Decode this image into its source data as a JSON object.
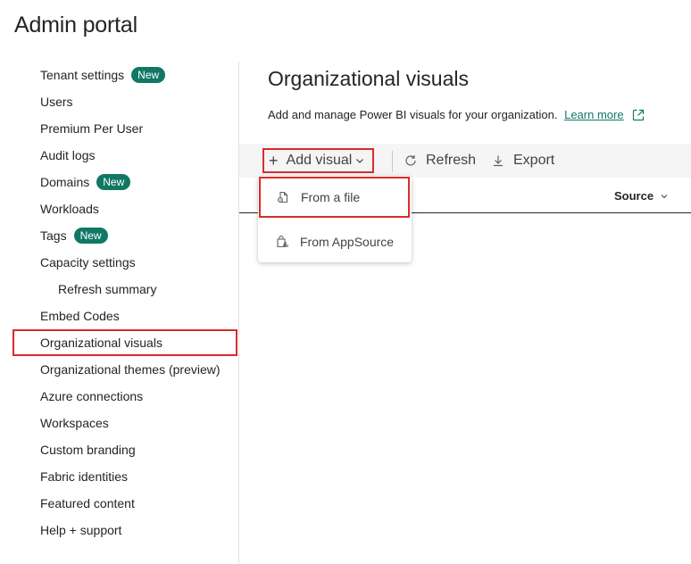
{
  "app": {
    "title": "Admin portal"
  },
  "sidebar": {
    "items": [
      {
        "label": "Tenant settings",
        "badge": "New"
      },
      {
        "label": "Users"
      },
      {
        "label": "Premium Per User"
      },
      {
        "label": "Audit logs"
      },
      {
        "label": "Domains",
        "badge": "New"
      },
      {
        "label": "Workloads"
      },
      {
        "label": "Tags",
        "badge": "New"
      },
      {
        "label": "Capacity settings"
      },
      {
        "label": "Refresh summary"
      },
      {
        "label": "Embed Codes"
      },
      {
        "label": "Organizational visuals",
        "selected": true
      },
      {
        "label": "Organizational themes (preview)"
      },
      {
        "label": "Azure connections"
      },
      {
        "label": "Workspaces"
      },
      {
        "label": "Custom branding"
      },
      {
        "label": "Fabric identities"
      },
      {
        "label": "Featured content"
      },
      {
        "label": "Help + support"
      }
    ]
  },
  "main": {
    "title": "Organizational visuals",
    "description": "Add and manage Power BI visuals for your organization.",
    "learn_more": "Learn more",
    "toolbar": {
      "add_visual": "Add visual",
      "refresh": "Refresh",
      "export": "Export"
    },
    "table": {
      "source_header": "Source"
    },
    "add_visual_menu": [
      {
        "label": "From a file",
        "icon": "file-visual-icon"
      },
      {
        "label": "From AppSource",
        "icon": "appsource-icon"
      }
    ]
  },
  "colors": {
    "accent": "#117865",
    "highlight": "#d92b2b",
    "toolbar_bg": "#f5f5f5"
  }
}
